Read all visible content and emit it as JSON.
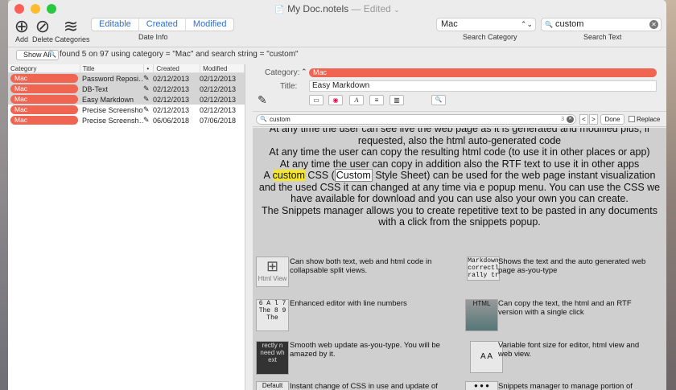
{
  "window": {
    "title": "My Doc.notels",
    "title_status": "Edited",
    "title_chevron": "⌄",
    "title_icon": "📄"
  },
  "toolbar": {
    "add": {
      "icon": "⊕",
      "label": "Add"
    },
    "delete": {
      "icon": "⊘",
      "label": "Delete"
    },
    "categories": {
      "icon": "≋",
      "label": "Categories"
    },
    "date_tabs": [
      "Editable",
      "Created",
      "Modified"
    ],
    "date_label": "Date Info",
    "category_value": "Mac",
    "category_arrow": "⌃⌄",
    "category_label": "Search Category",
    "search_icon": "🔍",
    "search_value": "custom",
    "search_clear": "✕",
    "search_label": "Search Text"
  },
  "filter": {
    "show_all": "Show All",
    "icon": "🔍",
    "status": "found 5 on 97 using  category = \"Mac\" and search string = \"custom\""
  },
  "table": {
    "headers": [
      "Category",
      "Title",
      "•",
      "Created",
      "Modified"
    ],
    "rows": [
      {
        "category": "Mac",
        "title": "Password Reposi…",
        "created": "02/12/2013",
        "modified": "02/12/2013"
      },
      {
        "category": "Mac",
        "title": "DB-Text",
        "created": "02/12/2013",
        "modified": "02/12/2013"
      },
      {
        "category": "Mac",
        "title": "Easy Markdown",
        "created": "02/12/2013",
        "modified": "02/12/2013"
      },
      {
        "category": "Mac",
        "title": "Precise Screenshot",
        "created": "02/12/2013",
        "modified": "02/12/2013"
      },
      {
        "category": "Mac",
        "title": "Precise Screensh…",
        "created": "06/06/2018",
        "modified": "07/06/2018"
      }
    ],
    "edit_icon": "✎"
  },
  "detail": {
    "category_label": "Category:",
    "category_arrow": "⌃",
    "category_value": "Mac",
    "title_label": "Title:",
    "title_value": "Easy Markdown",
    "pencil_icon": "✎",
    "format_buttons": [
      "▭",
      "◉",
      "A",
      "≡",
      "▥",
      "🔍"
    ]
  },
  "find": {
    "icon": "🔍",
    "value": "custom",
    "count": "3",
    "clear": "✕",
    "prev": "<",
    "next": ">",
    "done": "Done",
    "replace_label": "Replace"
  },
  "preview": {
    "p1": "At any time the user can see live the web page as it is generated and modified plus, if requested, also the html auto-generated code",
    "p2": "At any time the user can copy the resulting html code (to use it in other places or app)",
    "p3": "At any time the user can copy in addition also the RTF text to use it in other apps",
    "p4a": "A ",
    "p4_hl": "custom",
    "p4b": " CSS (",
    "p4_hl2": "Custom",
    "p4c": " Style Sheet) can be used for the web page instant visualization and the used CSS it can changed at any time via e popup menu. You can use the CSS we have available for download and you can use also your own you can create.",
    "p5": "The Snippets manager allows you to create repetitive text to be pasted in any documents with a click from the snippets popup.",
    "features": [
      {
        "text": "Can show both text, web and html code in collapsable split views.",
        "thumb": "Html View"
      },
      {
        "text": "Shows the text and the auto generated web page as-you-type",
        "thumb": "Markdown correctl rally tr"
      },
      {
        "text": "Enhanced editor with line numbers",
        "thumb": "6 A l 7 The 8 9 The"
      },
      {
        "text": "Can copy the text, the html and an RTF version with a single click",
        "thumb": "HTML"
      },
      {
        "text": "Smooth web update as-you-type. You will be amazed by it.",
        "thumb": "rectly n need wh ext"
      },
      {
        "text": "Variable font size for editor, html view and web view.",
        "thumb": "A A"
      },
      {
        "text": "Instant change of CSS in use and update of",
        "thumb": "Default"
      },
      {
        "text": "Snippets manager to manage portion of",
        "thumb": "● ● ●"
      }
    ]
  },
  "colors": {
    "accent": "#2d6fd6",
    "category_pill": "#f06452",
    "highlight": "#f5e62a",
    "close": "#fc5f57",
    "min": "#fdbc2e",
    "max": "#28c840"
  }
}
